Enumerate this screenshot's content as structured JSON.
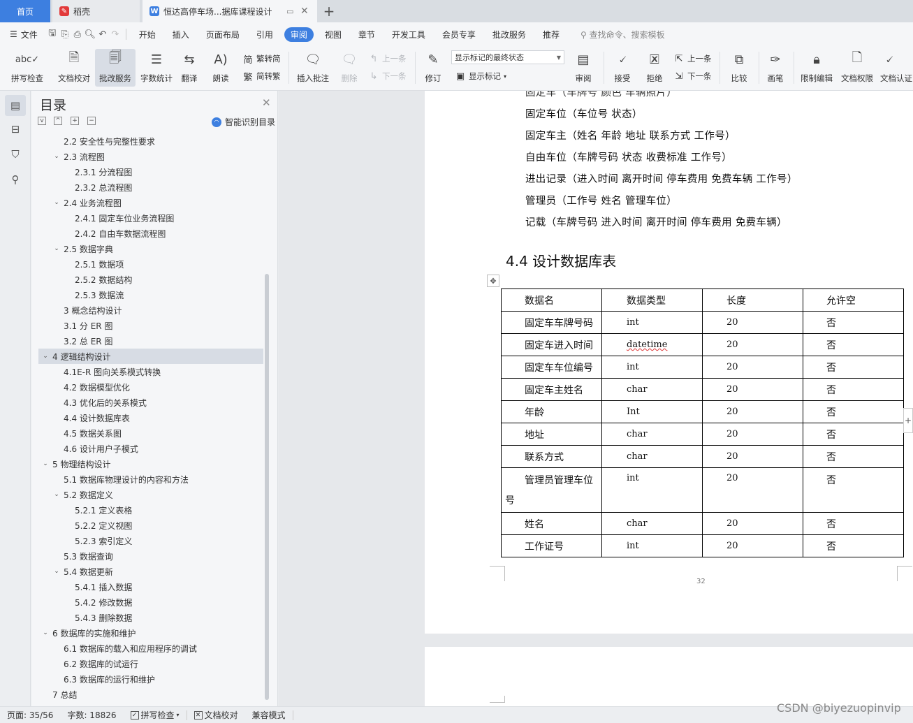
{
  "tabs": {
    "home": "首页",
    "daoke": "稻壳",
    "document": "恒达高停车场...据库课程设计"
  },
  "menu": {
    "file": "文件",
    "items": [
      "开始",
      "插入",
      "页面布局",
      "引用",
      "审阅",
      "视图",
      "章节",
      "开发工具",
      "会员专享",
      "批改服务",
      "推荐"
    ],
    "active": "审阅",
    "search_placeholder": "查找命令、搜索模板"
  },
  "ribbon": {
    "spell_check": "拼写检查",
    "doc_proof": "文档校对",
    "correction_service": "批改服务",
    "word_count": "字数统计",
    "translate": "翻译",
    "read_aloud": "朗读",
    "trad_to_simp": "繁转简",
    "simp_to_trad": "简转繁",
    "insert_comment": "插入批注",
    "delete": "删除",
    "prev": "上一条",
    "next": "下一条",
    "revise": "修订",
    "review_state": "显示标记的最终状态",
    "show_markup": "显示标记",
    "review": "审阅",
    "accept": "接受",
    "reject": "拒绝",
    "prev2": "上一条",
    "next2": "下一条",
    "compare": "比较",
    "pen": "画笔",
    "restrict_edit": "限制编辑",
    "doc_permission": "文档权限",
    "doc_certify": "文档认证"
  },
  "toc": {
    "title": "目录",
    "smart": "智能识别目录",
    "items": [
      {
        "text": "2.2 安全性与完整性要求",
        "level": 2,
        "arrow": ""
      },
      {
        "text": "2.3 流程图",
        "level": 2,
        "arrow": "v"
      },
      {
        "text": "2.3.1 分流程图",
        "level": 3,
        "arrow": ""
      },
      {
        "text": "2.3.2 总流程图",
        "level": 3,
        "arrow": ""
      },
      {
        "text": "2.4 业务流程图",
        "level": 2,
        "arrow": "v"
      },
      {
        "text": "2.4.1 固定车位业务流程图",
        "level": 3,
        "arrow": ""
      },
      {
        "text": "2.4.2 自由车数据流程图",
        "level": 3,
        "arrow": ""
      },
      {
        "text": "2.5 数据字典",
        "level": 2,
        "arrow": "v"
      },
      {
        "text": "2.5.1 数据项",
        "level": 3,
        "arrow": ""
      },
      {
        "text": "2.5.2 数据结构",
        "level": 3,
        "arrow": ""
      },
      {
        "text": "2.5.3  数据流",
        "level": 3,
        "arrow": ""
      },
      {
        "text": "3 概念结构设计",
        "level": 2,
        "arrow": ""
      },
      {
        "text": "3.1 分 ER 图",
        "level": 2,
        "arrow": ""
      },
      {
        "text": "3.2  总 ER 图",
        "level": 2,
        "arrow": ""
      },
      {
        "text": "4 逻辑结构设计",
        "level": 1,
        "arrow": "v",
        "selected": true
      },
      {
        "text": "4.1E-R 图向关系模式转换",
        "level": 2,
        "arrow": ""
      },
      {
        "text": "4.2 数据模型优化",
        "level": 2,
        "arrow": ""
      },
      {
        "text": "4.3 优化后的关系模式",
        "level": 2,
        "arrow": ""
      },
      {
        "text": "4.4 设计数据库表",
        "level": 2,
        "arrow": ""
      },
      {
        "text": "4.5 数据关系图",
        "level": 2,
        "arrow": ""
      },
      {
        "text": "4.6 设计用户子模式",
        "level": 2,
        "arrow": ""
      },
      {
        "text": "5 物理结构设计",
        "level": 1,
        "arrow": "v"
      },
      {
        "text": "5.1 数据库物理设计的内容和方法",
        "level": 2,
        "arrow": ""
      },
      {
        "text": "5.2 数据定义",
        "level": 2,
        "arrow": "v"
      },
      {
        "text": "5.2.1  定义表格",
        "level": 3,
        "arrow": ""
      },
      {
        "text": "5.2.2  定义视图",
        "level": 3,
        "arrow": ""
      },
      {
        "text": "5.2.3  索引定义",
        "level": 3,
        "arrow": ""
      },
      {
        "text": "5.3 数据查询",
        "level": 2,
        "arrow": ""
      },
      {
        "text": "5.4 数据更新",
        "level": 2,
        "arrow": "v"
      },
      {
        "text": "5.4.1 插入数据",
        "level": 3,
        "arrow": ""
      },
      {
        "text": "5.4.2  修改数据",
        "level": 3,
        "arrow": ""
      },
      {
        "text": "5.4.3 删除数据",
        "level": 3,
        "arrow": ""
      },
      {
        "text": "6 数据库的实施和维护",
        "level": 1,
        "arrow": "v"
      },
      {
        "text": "6.1 数据库的载入和应用程序的调试",
        "level": 2,
        "arrow": ""
      },
      {
        "text": "6.2 数据库的试运行",
        "level": 2,
        "arrow": ""
      },
      {
        "text": "6.3 数据库的运行和维护",
        "level": 2,
        "arrow": ""
      },
      {
        "text": "7 总结",
        "level": 1,
        "arrow": ""
      }
    ]
  },
  "doc": {
    "partial_top": "固定车（车牌号  颜色  车辆照片）",
    "relations": [
      "固定车位（车位号  状态）",
      "固定车主（姓名  年龄  地址  联系方式  工作号）",
      "自由车位（车牌号码  状态  收费标准  工作号）",
      "进出记录（进入时间  离开时间  停车费用  免费车辆  工作号）",
      "管理员（工作号  姓名  管理车位）",
      "记载（车牌号码  进入时间  离开时间  停车费用  免费车辆）"
    ],
    "heading": "4.4 设计数据库表",
    "table_header": [
      "数据名",
      "数据类型",
      "长度",
      "允许空"
    ],
    "table_rows": [
      [
        "固定车车牌号码",
        "int",
        "20",
        "否"
      ],
      [
        "固定车进入时间",
        "datetime",
        "20",
        "否"
      ],
      [
        "固定车车位编号",
        "int",
        "20",
        "否"
      ],
      [
        "固定车主姓名",
        "char",
        "20",
        "否"
      ],
      [
        "年龄",
        "Int",
        "20",
        "否"
      ],
      [
        "地址",
        "char",
        "20",
        "否"
      ],
      [
        "联系方式",
        "char",
        "20",
        "否"
      ],
      [
        "管理员管理车位号",
        "int",
        "20",
        "否"
      ],
      [
        "姓名",
        "char",
        "20",
        "否"
      ],
      [
        "工作证号",
        "int",
        "20",
        "否"
      ]
    ],
    "wrap_first": "管理员管理车位",
    "wrap_rest": "号",
    "page_number": "32"
  },
  "status": {
    "page": "页面: 35/56",
    "words": "字数: 18826",
    "spell": "拼写检查",
    "proof": "文档校对",
    "compat": "兼容模式"
  },
  "watermark": "CSDN @biyezuopinvip"
}
